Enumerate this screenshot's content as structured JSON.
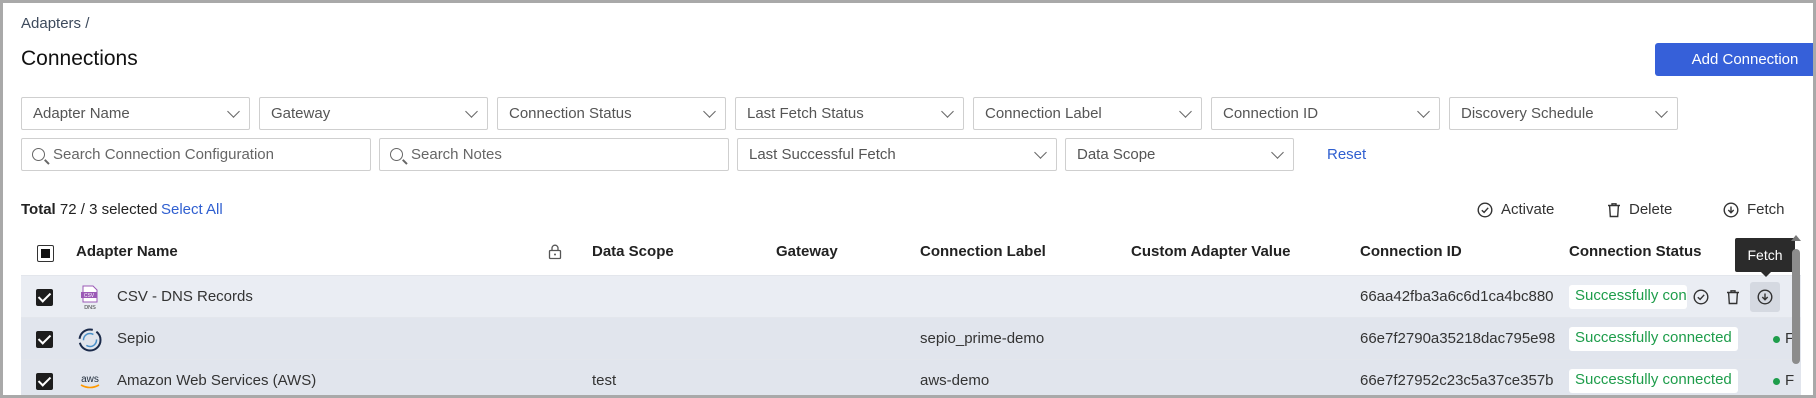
{
  "breadcrumb": "Adapters /",
  "page_title": "Connections",
  "add_button": "Add Connection",
  "filters": {
    "adapter_name": "Adapter Name",
    "gateway": "Gateway",
    "connection_status": "Connection Status",
    "last_fetch_status": "Last Fetch Status",
    "connection_label": "Connection Label",
    "connection_id": "Connection ID",
    "discovery_schedule": "Discovery Schedule",
    "last_successful_fetch": "Last Successful Fetch",
    "data_scope": "Data Scope",
    "search_config_placeholder": "Search Connection Configuration",
    "search_notes_placeholder": "Search Notes",
    "reset": "Reset"
  },
  "summary": {
    "total_label": "Total",
    "total_text": "72 / 3 selected",
    "select_all": "Select All"
  },
  "actions": {
    "activate": "Activate",
    "delete": "Delete",
    "fetch": "Fetch"
  },
  "columns": {
    "adapter_name": "Adapter Name",
    "data_scope": "Data Scope",
    "gateway": "Gateway",
    "connection_label": "Connection Label",
    "custom_adapter_value": "Custom Adapter Value",
    "connection_id": "Connection ID",
    "connection_status": "Connection Status"
  },
  "tooltip": "Fetch",
  "rows": [
    {
      "adapter": "CSV - DNS Records",
      "logo": "csv-dns-icon",
      "logo_text_top": "CSV",
      "logo_text_bottom": "DNS",
      "data_scope": "",
      "gateway": "",
      "connection_label": "",
      "custom_value": "",
      "connection_id": "66aa42fba3a6c6d1ca4bc880",
      "status": "Successfully connected",
      "selected": true
    },
    {
      "adapter": "Sepio",
      "logo": "sepio-icon",
      "data_scope": "",
      "gateway": "",
      "connection_label": "sepio_prime-demo",
      "custom_value": "",
      "connection_id": "66e7f2790a35218dac795e98",
      "status": "Successfully connected",
      "fetch_cut": "F",
      "selected": true
    },
    {
      "adapter": "Amazon Web Services (AWS)",
      "logo": "aws-icon",
      "logo_text": "aws",
      "data_scope": "test",
      "gateway": "",
      "connection_label": "aws-demo",
      "custom_value": "",
      "connection_id": "66e7f27952c23c5a37ce357b",
      "status": "Successfully connected",
      "fetch_cut": "F",
      "selected": true
    }
  ],
  "colors": {
    "primary": "#3660d9",
    "link": "#2f5fd0",
    "success": "#1e9d4b",
    "selected_row": "#e1e5ed"
  }
}
